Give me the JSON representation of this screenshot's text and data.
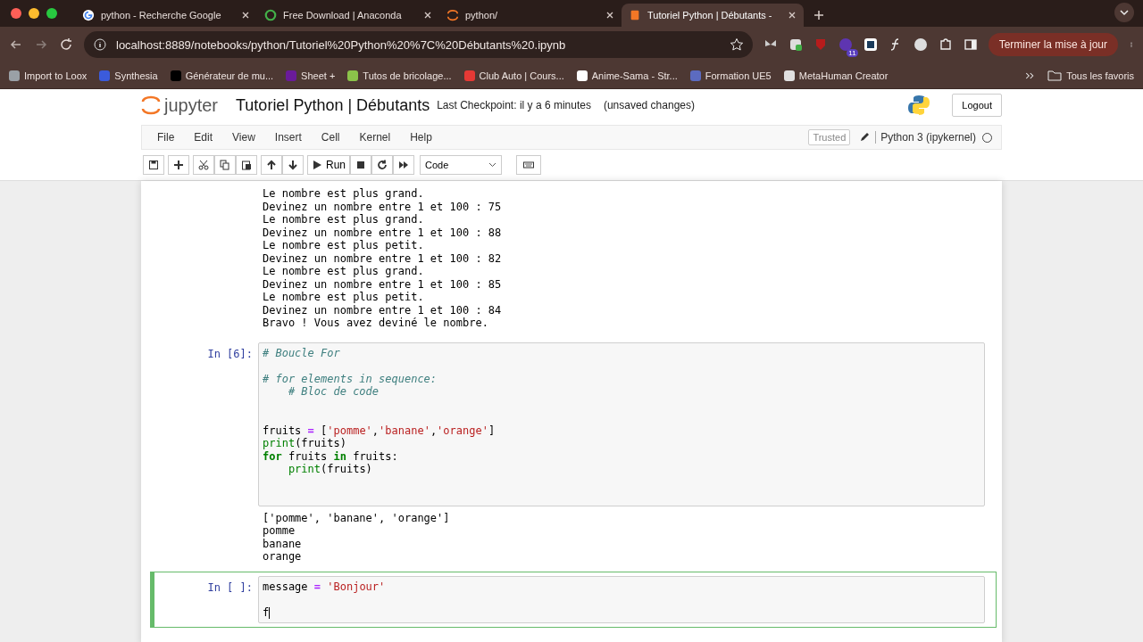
{
  "browser": {
    "tabs": [
      {
        "title": "python - Recherche Google",
        "selected": false
      },
      {
        "title": "Free Download | Anaconda",
        "selected": false
      },
      {
        "title": "python/",
        "selected": false
      },
      {
        "title": "Tutoriel Python | Débutants -",
        "selected": true
      }
    ],
    "address": "localhost:8889/notebooks/python/Tutoriel%20Python%20%7C%20Débutants%20.ipynb",
    "extension_badge": "11",
    "update_button": "Terminer la mise à jour",
    "bookmarks": [
      {
        "label": "Import to Loox",
        "color": "#9aa0a6"
      },
      {
        "label": "Synthesia",
        "color": "#3b5bdb"
      },
      {
        "label": "Générateur de mu...",
        "color": "#000000"
      },
      {
        "label": "Sheet +",
        "color": "#6a1b9a"
      },
      {
        "label": "Tutos de bricolage...",
        "color": "#8bc34a"
      },
      {
        "label": "Club Auto | Cours...",
        "color": "#e53935"
      },
      {
        "label": "Anime-Sama - Str...",
        "color": "#ffffff"
      },
      {
        "label": "Formation UE5",
        "color": "#5c6bc0"
      },
      {
        "label": "MetaHuman Creator",
        "color": "#e0e0e0"
      }
    ],
    "all_bookmarks": "Tous les favoris"
  },
  "jupyter": {
    "logo": "jupyter",
    "notebook_title": "Tutoriel Python | Débutants",
    "checkpoint": "Last Checkpoint: il y a 6 minutes",
    "unsaved": "(unsaved changes)",
    "logout": "Logout",
    "menu": [
      "File",
      "Edit",
      "View",
      "Insert",
      "Cell",
      "Kernel",
      "Help"
    ],
    "trusted": "Trusted",
    "kernel": "Python 3 (ipykernel)",
    "run": "Run",
    "cell_type": "Code"
  },
  "cells": [
    {
      "kind": "output",
      "output": [
        "Le nombre est plus grand.",
        "Devinez un nombre entre 1 et 100 : 75",
        "Le nombre est plus grand.",
        "Devinez un nombre entre 1 et 100 : 88",
        "Le nombre est plus petit.",
        "Devinez un nombre entre 1 et 100 : 82",
        "Le nombre est plus grand.",
        "Devinez un nombre entre 1 et 100 : 85",
        "Le nombre est plus petit.",
        "Devinez un nombre entre 1 et 100 : 84",
        "Bravo ! Vous avez deviné le nombre."
      ]
    },
    {
      "kind": "code",
      "prompt": "In [6]:",
      "selected": false,
      "lines": [
        {
          "kind": "code",
          "tokens": [
            {
              "kind": "comment",
              "text": "# Boucle For"
            }
          ]
        },
        {
          "kind": "blank"
        },
        {
          "kind": "code",
          "tokens": [
            {
              "kind": "comment",
              "text": "# for elements in sequence:"
            }
          ]
        },
        {
          "kind": "code",
          "tokens": [
            {
              "kind": "comment",
              "text": "    # Bloc de code"
            }
          ]
        },
        {
          "kind": "blank"
        },
        {
          "kind": "blank"
        },
        {
          "kind": "code",
          "tokens": [
            {
              "kind": "plain",
              "text": "fruits "
            },
            {
              "kind": "operator",
              "text": "="
            },
            {
              "kind": "plain",
              "text": " ["
            },
            {
              "kind": "string",
              "text": "'pomme'"
            },
            {
              "kind": "plain",
              "text": ","
            },
            {
              "kind": "string",
              "text": "'banane'"
            },
            {
              "kind": "plain",
              "text": ","
            },
            {
              "kind": "string",
              "text": "'orange'"
            },
            {
              "kind": "plain",
              "text": "]"
            }
          ]
        },
        {
          "kind": "code",
          "tokens": [
            {
              "kind": "builtin",
              "text": "print"
            },
            {
              "kind": "plain",
              "text": "(fruits)"
            }
          ]
        },
        {
          "kind": "code",
          "tokens": [
            {
              "kind": "keyword",
              "text": "for"
            },
            {
              "kind": "plain",
              "text": " fruits "
            },
            {
              "kind": "keyword",
              "text": "in"
            },
            {
              "kind": "plain",
              "text": " fruits:"
            }
          ]
        },
        {
          "kind": "code",
          "tokens": [
            {
              "kind": "builtin",
              "text": "    print"
            },
            {
              "kind": "plain",
              "text": "(fruits)"
            }
          ]
        },
        {
          "kind": "blank"
        },
        {
          "kind": "blank"
        }
      ],
      "output": [
        "['pomme', 'banane', 'orange']",
        "pomme",
        "banane",
        "orange"
      ]
    },
    {
      "kind": "code",
      "prompt": "In [ ]:",
      "selected": true,
      "lines": [
        {
          "kind": "code",
          "tokens": [
            {
              "kind": "plain",
              "text": "message "
            },
            {
              "kind": "operator",
              "text": "="
            },
            {
              "kind": "string",
              "text": " 'Bonjour'"
            }
          ]
        },
        {
          "kind": "blank"
        },
        {
          "kind": "code",
          "tokens": [
            {
              "kind": "plain",
              "text": "f"
            }
          ]
        }
      ],
      "cursor": true
    }
  ]
}
